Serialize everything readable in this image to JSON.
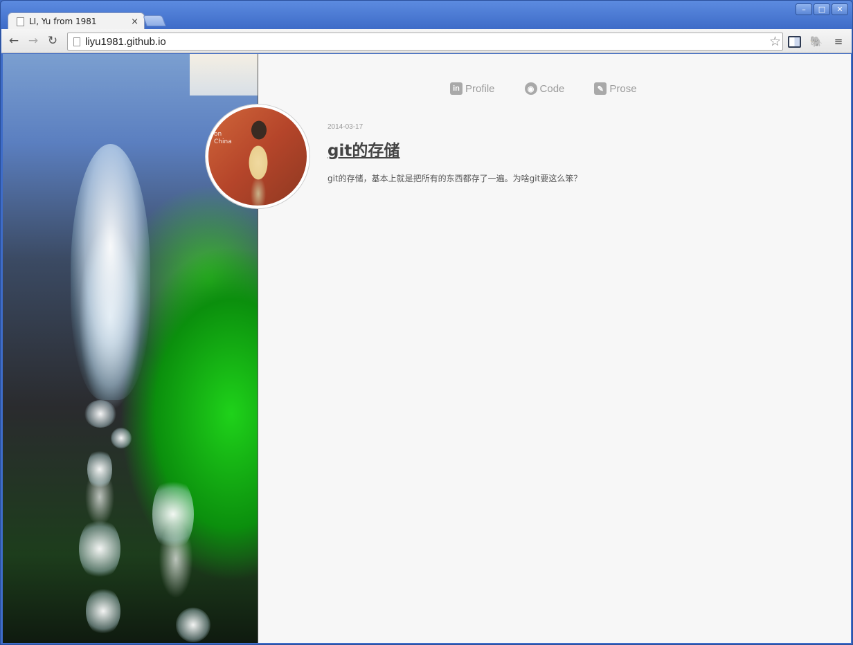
{
  "window": {
    "controls": [
      "–",
      "□",
      "✕"
    ]
  },
  "tab": {
    "title": "LI, Yu from 1981",
    "close": "×"
  },
  "toolbar": {
    "back": "←",
    "forward": "→",
    "reload": "↻",
    "url": "liyu1981.github.io",
    "star": "☆",
    "menu": "≡"
  },
  "avatar": {
    "caption": "on\nChina"
  },
  "nav": {
    "items": [
      {
        "label": "Profile",
        "icon": "in",
        "icon_name": "linkedin-icon"
      },
      {
        "label": "Code",
        "icon": "◉",
        "icon_name": "github-icon"
      },
      {
        "label": "Prose",
        "icon": "✎",
        "icon_name": "pencil-icon"
      }
    ]
  },
  "post": {
    "date": "2014-03-17",
    "title": "git的存储",
    "excerpt": "git的存储，基本上就是把所有的东西都存了一遍。为啥git要这么笨？"
  }
}
